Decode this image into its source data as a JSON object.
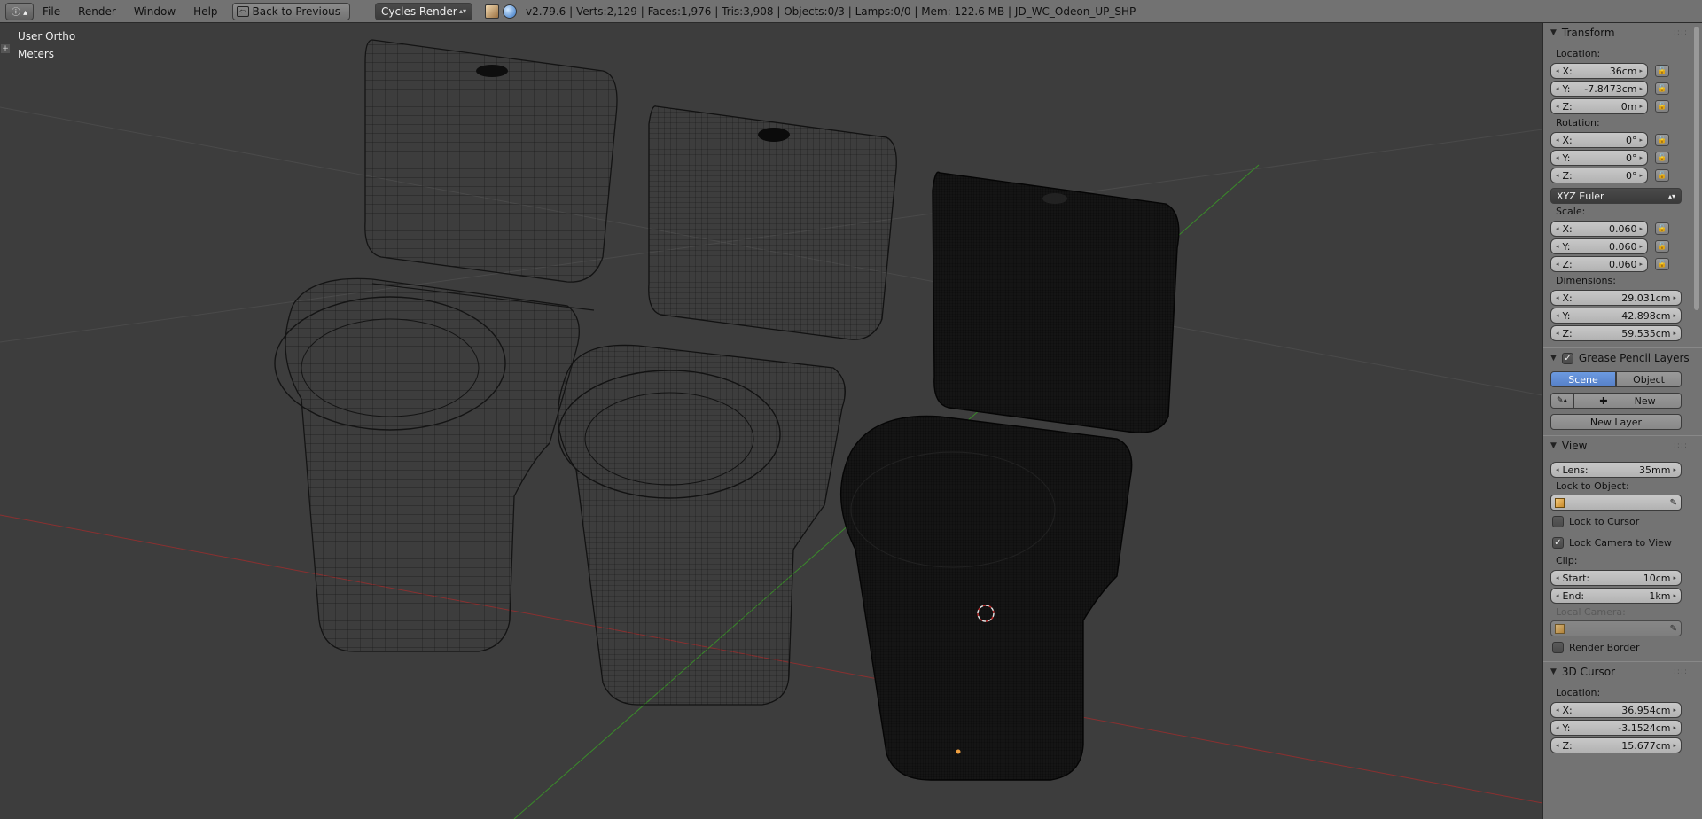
{
  "header": {
    "editor_type_icon": "info-icon",
    "menus": [
      "File",
      "Render",
      "Window",
      "Help"
    ],
    "back_button": "Back to Previous",
    "render_engine": "Cycles Render",
    "stats": "v2.79.6 | Verts:2,129 | Faces:1,976 | Tris:3,908 | Objects:0/3 | Lamps:0/0 | Mem: 122.6 MB | JD_WC_Odeon_UP_SHP"
  },
  "viewport": {
    "view_name": "User Ortho",
    "units": "Meters"
  },
  "panel": {
    "transform": {
      "title": "Transform",
      "location_label": "Location:",
      "location": [
        {
          "k": "X:",
          "v": "36cm"
        },
        {
          "k": "Y:",
          "v": "-7.8473cm"
        },
        {
          "k": "Z:",
          "v": "0m"
        }
      ],
      "rotation_label": "Rotation:",
      "rotation": [
        {
          "k": "X:",
          "v": "0°"
        },
        {
          "k": "Y:",
          "v": "0°"
        },
        {
          "k": "Z:",
          "v": "0°"
        }
      ],
      "rotation_mode": "XYZ Euler",
      "scale_label": "Scale:",
      "scale": [
        {
          "k": "X:",
          "v": "0.060"
        },
        {
          "k": "Y:",
          "v": "0.060"
        },
        {
          "k": "Z:",
          "v": "0.060"
        }
      ],
      "dimensions_label": "Dimensions:",
      "dimensions": [
        {
          "k": "X:",
          "v": "29.031cm"
        },
        {
          "k": "Y:",
          "v": "42.898cm"
        },
        {
          "k": "Z:",
          "v": "59.535cm"
        }
      ]
    },
    "grease_pencil": {
      "title": "Grease Pencil Layers",
      "tab_scene": "Scene",
      "tab_object": "Object",
      "new_label": "New",
      "new_layer_label": "New Layer"
    },
    "view": {
      "title": "View",
      "lens_label": "Lens:",
      "lens_value": "35mm",
      "lock_to_object_label": "Lock to Object:",
      "lock_to_cursor_label": "Lock to Cursor",
      "lock_camera_label": "Lock Camera to View",
      "clip_label": "Clip:",
      "clip_start_label": "Start:",
      "clip_start_value": "10cm",
      "clip_end_label": "End:",
      "clip_end_value": "1km",
      "local_camera_label": "Local Camera:",
      "render_border_label": "Render Border"
    },
    "cursor": {
      "title": "3D Cursor",
      "location_label": "Location:",
      "location": [
        {
          "k": "X:",
          "v": "36.954cm"
        },
        {
          "k": "Y:",
          "v": "-3.1524cm"
        },
        {
          "k": "Z:",
          "v": "15.677cm"
        }
      ]
    }
  },
  "colors": {
    "header_bg": "#727272",
    "viewport_bg": "#3d3d3d",
    "panel_bg": "#737373",
    "accent_blue": "#5680c8",
    "x_axis": "#8a3030",
    "y_axis": "#3a8a2a"
  }
}
